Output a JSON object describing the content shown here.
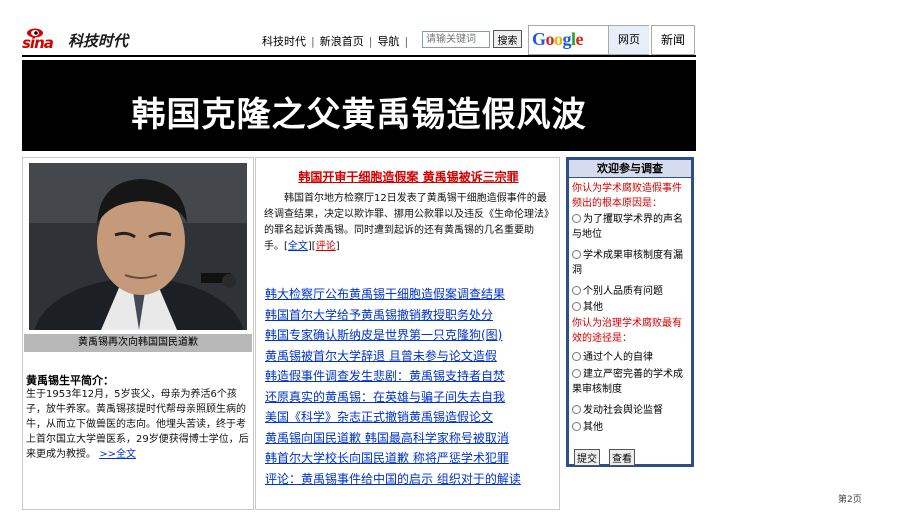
{
  "header": {
    "logo_text": "sina",
    "channel": "科技时代",
    "nav": [
      "科技时代",
      "新浪首页",
      "导航"
    ],
    "search_placeholder": "请输关键词",
    "search_button": "搜索",
    "google_tab": "网页",
    "news_tab": "新闻"
  },
  "banner": {
    "title": "韩国克隆之父黄禹锡造假风波"
  },
  "left": {
    "photo_caption": "黄禹锡再次向韩国国民道歉",
    "bio_title": "黄禹锡生平简介：",
    "bio_text": "生于1953年12月，5岁丧父，母亲为养活6个孩子，放牛养家。黄禹锡孩提时代帮母亲照顾生病的牛，从而立下做兽医的志向。他埋头苦读，终于考上首尔国立大学兽医系，29岁便获得博士学位，后来更成为教授。",
    "bio_more": ">>全文"
  },
  "middle": {
    "headline": "韩国开审干细胞造假案 黄禹锡被诉三宗罪",
    "lead_text": "韩国首尔地方检察厅12日发表了黄禹锡干细胞造假事件的最终调查结果，决定以欺诈罪、挪用公款罪以及违反《生命伦理法》的罪名起诉黄禹锡。同时遭到起诉的还有黄禹锡的几名重要助手。",
    "lead_link_full": "全文",
    "lead_link_comment": "评论",
    "news": [
      "韩大检察厅公布黄禹锡干细胞造假案调查结果",
      "韩国首尔大学给予黄禹锡撤销教授职务处分",
      "韩国专家确认斯纳皮是世界第一只克隆狗(图)",
      "黄禹锡被首尔大学辞退 且曾未参与论文造假",
      "韩造假事件调查发生悲剧：黄禹锡支持者自焚",
      "还原真实的黄禹锡：在英雄与骗子间失去自我",
      "美国《科学》杂志正式撤销黄禹锡造假论文",
      "黄禹锡向国民道歉 韩国最高科学家称号被取消",
      "韩首尔大学校长向国民道歉 称将严惩学术犯罪",
      "评论：黄禹锡事件给中国的启示 组织对于的解读"
    ]
  },
  "poll": {
    "title": "欢迎参与调查",
    "q1": "你认为学术腐败造假事件频出的根本原因是：",
    "q1_options": [
      "为了攫取学术界的声名与地位",
      "学术成果审核制度有漏洞",
      "个别人品质有问题",
      "其他"
    ],
    "q2": "你认为治理学术腐败最有效的途径是：",
    "q2_options": [
      "通过个人的自律",
      "建立严密完善的学术成果审核制度",
      "发动社会舆论监督",
      "其他"
    ],
    "submit": "提交",
    "view": "查看"
  },
  "page_number": "第2页"
}
